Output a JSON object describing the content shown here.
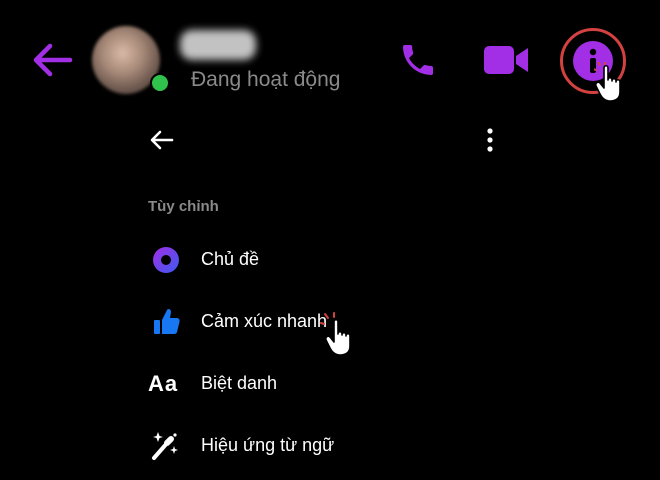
{
  "header": {
    "status": "Đang hoạt động",
    "icons": [
      "back-arrow-icon",
      "call-icon",
      "video-icon",
      "info-icon"
    ],
    "accent_color": "#a22ee6",
    "online_color": "#31c24d"
  },
  "menu": {
    "section_title": "Tùy chỉnh",
    "items": [
      {
        "label": "Chủ đề",
        "icon": "theme-icon"
      },
      {
        "label": "Cảm xúc nhanh",
        "icon": "thumbs-up-icon"
      },
      {
        "label": "Biệt danh",
        "icon": "nickname-icon",
        "icon_text": "Aa"
      },
      {
        "label": "Hiệu ứng từ ngữ",
        "icon": "sparkle-wand-icon"
      }
    ]
  }
}
